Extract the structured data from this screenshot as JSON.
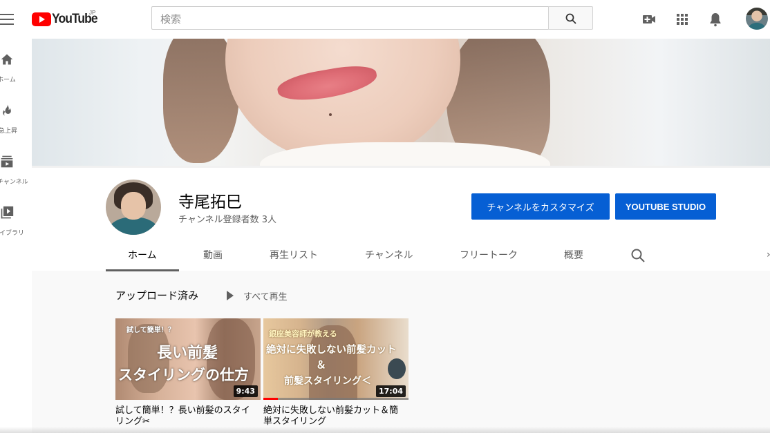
{
  "masthead": {
    "logo_text": "YouTube",
    "country_code": "JP",
    "search_placeholder": "検索"
  },
  "guide": {
    "items": [
      {
        "label": "ホーム",
        "icon": "home-icon"
      },
      {
        "label": "急上昇",
        "icon": "trending-flame-icon"
      },
      {
        "label": "チャンネル",
        "icon": "subscriptions-icon"
      },
      {
        "label": "ライブラリ",
        "icon": "library-icon"
      }
    ]
  },
  "channel": {
    "name": "寺尾拓巳",
    "subscribers": "チャンネル登録者数 3人",
    "customize_button": "チャンネルをカスタマイズ",
    "studio_button": "YOUTUBE STUDIO",
    "tabs": [
      {
        "label": "ホーム",
        "active": true
      },
      {
        "label": "動画"
      },
      {
        "label": "再生リスト"
      },
      {
        "label": "チャンネル"
      },
      {
        "label": "フリートーク"
      },
      {
        "label": "概要"
      }
    ],
    "tab_next_icon": "›"
  },
  "section": {
    "title": "アップロード済み",
    "play_all": "すべて再生"
  },
  "videos": [
    {
      "title": "試して簡単！？長い前髪のスタイリング✂︎",
      "duration": "9:43",
      "thumb_small_text": "試して簡単！？",
      "thumb_big_text_1": "長い前髪",
      "thumb_big_text_2": "スタイリングの仕方",
      "watched_fraction": 0
    },
    {
      "title": "絶対に失敗しない前髪カット＆簡単スタイリング",
      "duration": "17:04",
      "thumb_text_1": "銀座美容師が教える",
      "thumb_text_2": "絶対に失敗しない前髪カット",
      "thumb_text_3": "＆",
      "thumb_text_4": "前髪スタイリング＜",
      "watched_fraction": 0.1
    }
  ],
  "colors": {
    "brand_red": "#ff0000",
    "button_blue": "#065fd4"
  }
}
